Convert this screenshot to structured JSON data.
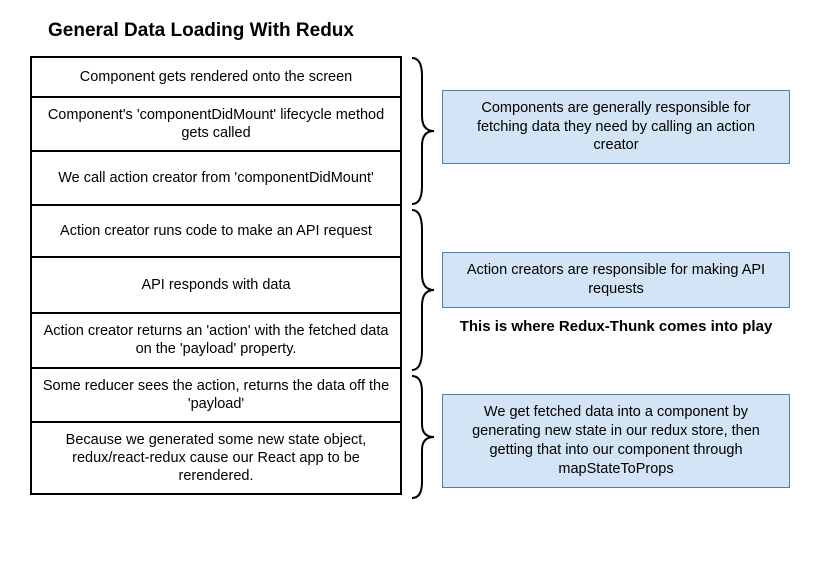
{
  "title": "General Data Loading With Redux",
  "steps": [
    "Component gets rendered onto the screen",
    "Component's 'componentDidMount' lifecycle method gets called",
    "We call action creator from 'componentDidMount'",
    "Action creator runs code to make an API request",
    "API responds with data",
    "Action creator returns an 'action' with the fetched data on the 'payload' property.",
    "Some reducer sees the action, returns the data off the 'payload'",
    "Because we generated some new state object, redux/react-redux cause our React app to be rerendered."
  ],
  "notes": [
    "Components are generally responsible for fetching data they need by calling an action creator",
    "Action creators are responsible for making API requests",
    "We get fetched data into a component by generating new state in our redux store, then getting that into our component through mapStateToProps"
  ],
  "caption": "This is where Redux-Thunk comes into play"
}
